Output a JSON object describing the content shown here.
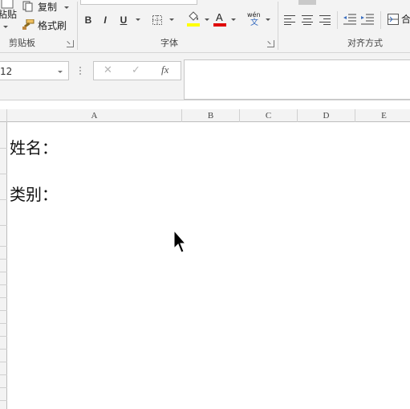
{
  "ribbon": {
    "clipboard": {
      "paste_label": "粘贴",
      "copy_label": "复制",
      "format_painter_label": "格式刷",
      "group_label": "剪贴板"
    },
    "font": {
      "bold_label": "B",
      "italic_label": "I",
      "underline_label": "U",
      "font_color_label": "A",
      "phonetic_top": "wén",
      "phonetic_bottom": "文",
      "group_label": "字体",
      "highlight_color": "#ffff00",
      "font_color": "#e00000"
    },
    "alignment": {
      "merge_label": "合",
      "group_label": "对齐方式"
    }
  },
  "formula_bar": {
    "name_box_value": "12",
    "cancel_icon": "✕",
    "enter_icon": "✓",
    "fx_label": "fx",
    "formula_value": ""
  },
  "sheet": {
    "columns": [
      "A",
      "B",
      "C",
      "D",
      "E"
    ],
    "cells": {
      "a1": "姓名：",
      "a3": "类别："
    }
  }
}
